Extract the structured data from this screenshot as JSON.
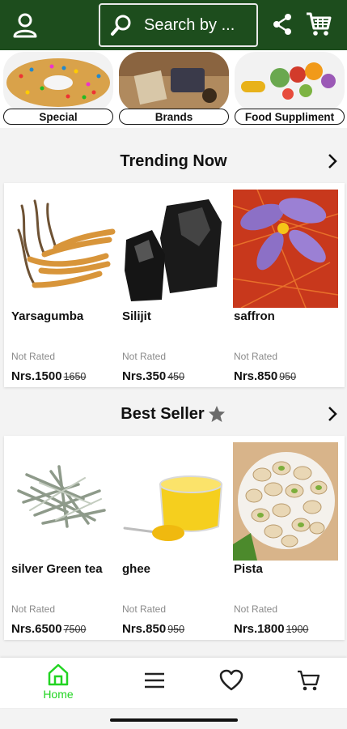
{
  "header": {
    "search_placeholder": "Search by ...",
    "bg_color": "#1d4d1d",
    "icons": [
      "user-icon",
      "search-icon",
      "share-icon",
      "cart-icon"
    ]
  },
  "categories": [
    {
      "label": "Special"
    },
    {
      "label": "Brands"
    },
    {
      "label": "Food Suppliment"
    }
  ],
  "trending": {
    "title": "Trending Now",
    "products": [
      {
        "name": "Yarsagumba",
        "rating": "Not Rated",
        "price": "Nrs.1500",
        "old_price": "1650"
      },
      {
        "name": "Silijit",
        "rating": "Not Rated",
        "price": "Nrs.350",
        "old_price": "450"
      },
      {
        "name": "saffron",
        "rating": "Not Rated",
        "price": "Nrs.850",
        "old_price": "950"
      }
    ]
  },
  "bestseller": {
    "title": "Best Seller",
    "products": [
      {
        "name": "silver Green tea",
        "rating": "Not Rated",
        "price": "Nrs.6500",
        "old_price": "7500"
      },
      {
        "name": "ghee",
        "rating": "Not Rated",
        "price": "Nrs.850",
        "old_price": "950"
      },
      {
        "name": "Pista",
        "rating": "Not Rated",
        "price": "Nrs.1800",
        "old_price": "1900"
      }
    ]
  },
  "bottom_nav": {
    "home_label": "Home",
    "active_color": "#22d422"
  }
}
